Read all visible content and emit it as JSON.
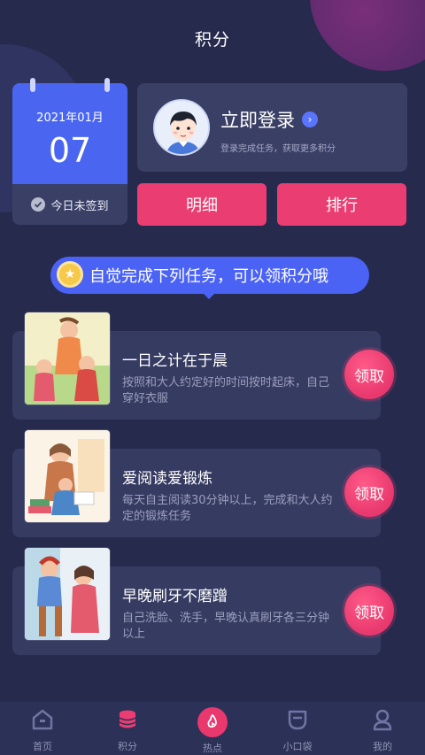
{
  "header": {
    "title": "积分"
  },
  "calendar": {
    "date": "2021年01月",
    "day": "07",
    "status": "今日未签到"
  },
  "login": {
    "title": "立即登录",
    "subtitle": "登录完成任务，获取更多积分"
  },
  "buttons": {
    "detail": "明细",
    "rank": "排行"
  },
  "banner": {
    "text": "自觉完成下列任务，可以领积分哦"
  },
  "tasks": [
    {
      "title": "一日之计在于晨",
      "desc": "按照和大人约定好的时间按时起床，自己穿好衣服",
      "action": "领取"
    },
    {
      "title": "爱阅读爱锻炼",
      "desc": "每天自主阅读30分钟以上，完成和大人约定的锻炼任务",
      "action": "领取"
    },
    {
      "title": "早晚刷牙不磨蹭",
      "desc": "自己洗脸、洗手，早晚认真刷牙各三分钟以上",
      "action": "领取"
    }
  ],
  "tabbar": {
    "items": [
      {
        "label": "首页",
        "icon": "home-icon"
      },
      {
        "label": "积分",
        "icon": "coins-icon",
        "active": true
      },
      {
        "label": "热点",
        "icon": "hot-play-icon"
      },
      {
        "label": "小口袋",
        "icon": "pocket-icon"
      },
      {
        "label": "我的",
        "icon": "profile-icon"
      }
    ]
  },
  "colors": {
    "background": "#262a4d",
    "accent": "#ea3d72",
    "blue": "#4a66f0",
    "card": "#3a3f66"
  }
}
